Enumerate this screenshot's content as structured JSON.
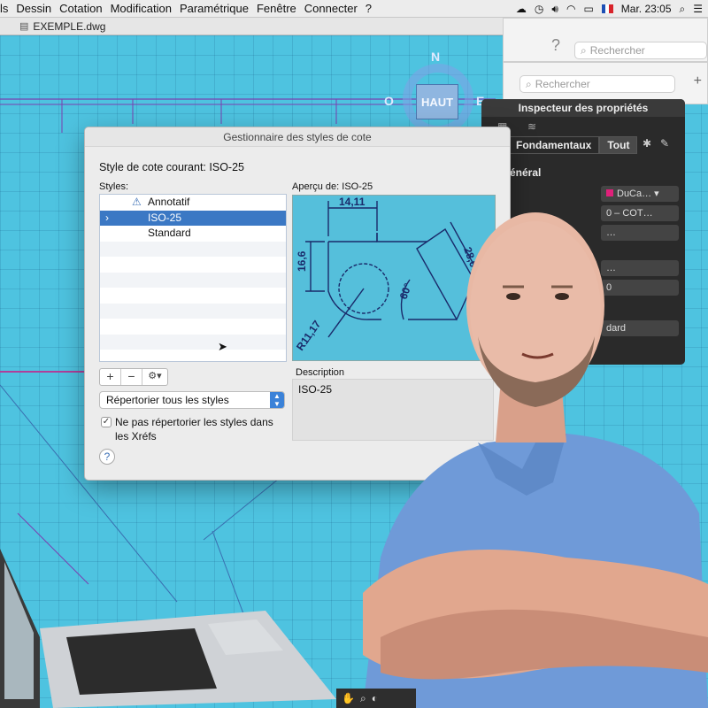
{
  "menubar": {
    "items": [
      "ls",
      "Dessin",
      "Cotation",
      "Modification",
      "Paramétrique",
      "Fenêtre",
      "Connecter",
      "?"
    ],
    "clock": "Mar. 23:05"
  },
  "document": {
    "title": "EXEMPLE.dwg"
  },
  "search": {
    "placeholder_1": "Rechercher",
    "placeholder_2": "Rechercher"
  },
  "viewcube": {
    "face": "HAUT",
    "north": "N",
    "east": "E",
    "west": "O"
  },
  "inspector": {
    "title": "Inspecteur des propriétés",
    "tabs": [
      "Fondamentaux",
      "Tout"
    ],
    "section": "énéral",
    "values": [
      "DuCa…",
      "0 – COT…",
      "…",
      "…",
      "0",
      "dard"
    ]
  },
  "dialog": {
    "title": "Gestionnaire des styles de cote",
    "current_style_label": "Style de cote courant: ISO-25",
    "styles_label": "Styles:",
    "styles": [
      {
        "name": "Annotatif",
        "selected": false
      },
      {
        "name": "ISO-25",
        "selected": true
      },
      {
        "name": "Standard",
        "selected": false
      }
    ],
    "preview_label": "Aperçu de: ISO-25",
    "preview_dims": {
      "top": "14,11",
      "left": "16,6",
      "right": "28,07",
      "angle": "60°",
      "radius": "R11,17"
    },
    "buttons": {
      "add": "+",
      "remove": "−",
      "gear": "⚙▾"
    },
    "list_filter": "Répertorier tous les styles",
    "xref_checkbox": "Ne pas répertorier les styles dans les Xréfs",
    "description_label": "Description",
    "description": "ISO-25",
    "help": "?"
  }
}
